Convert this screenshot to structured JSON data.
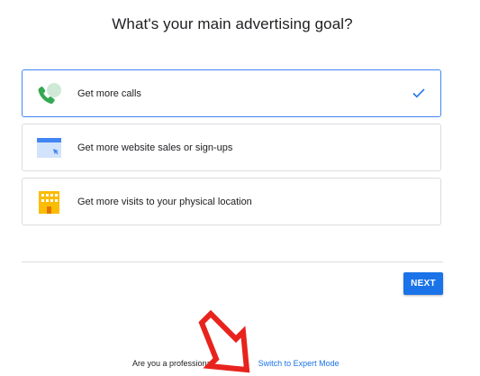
{
  "heading": "What's your main advertising goal?",
  "options": [
    {
      "label": "Get more calls",
      "icon": "phone-icon",
      "selected": true
    },
    {
      "label": "Get more website sales or sign-ups",
      "icon": "browser-window-icon",
      "selected": false
    },
    {
      "label": "Get more visits to your physical location",
      "icon": "building-icon",
      "selected": false
    }
  ],
  "next_label": "NEXT",
  "footer": {
    "prefix": "Are you a professiona",
    "link": "Switch to Expert Mode"
  },
  "colors": {
    "accent": "#1a73e8",
    "selected_border": "#4285f4",
    "phone_green": "#34a853",
    "building_yellow": "#fbbc04",
    "annotation_red": "#e8231d"
  }
}
